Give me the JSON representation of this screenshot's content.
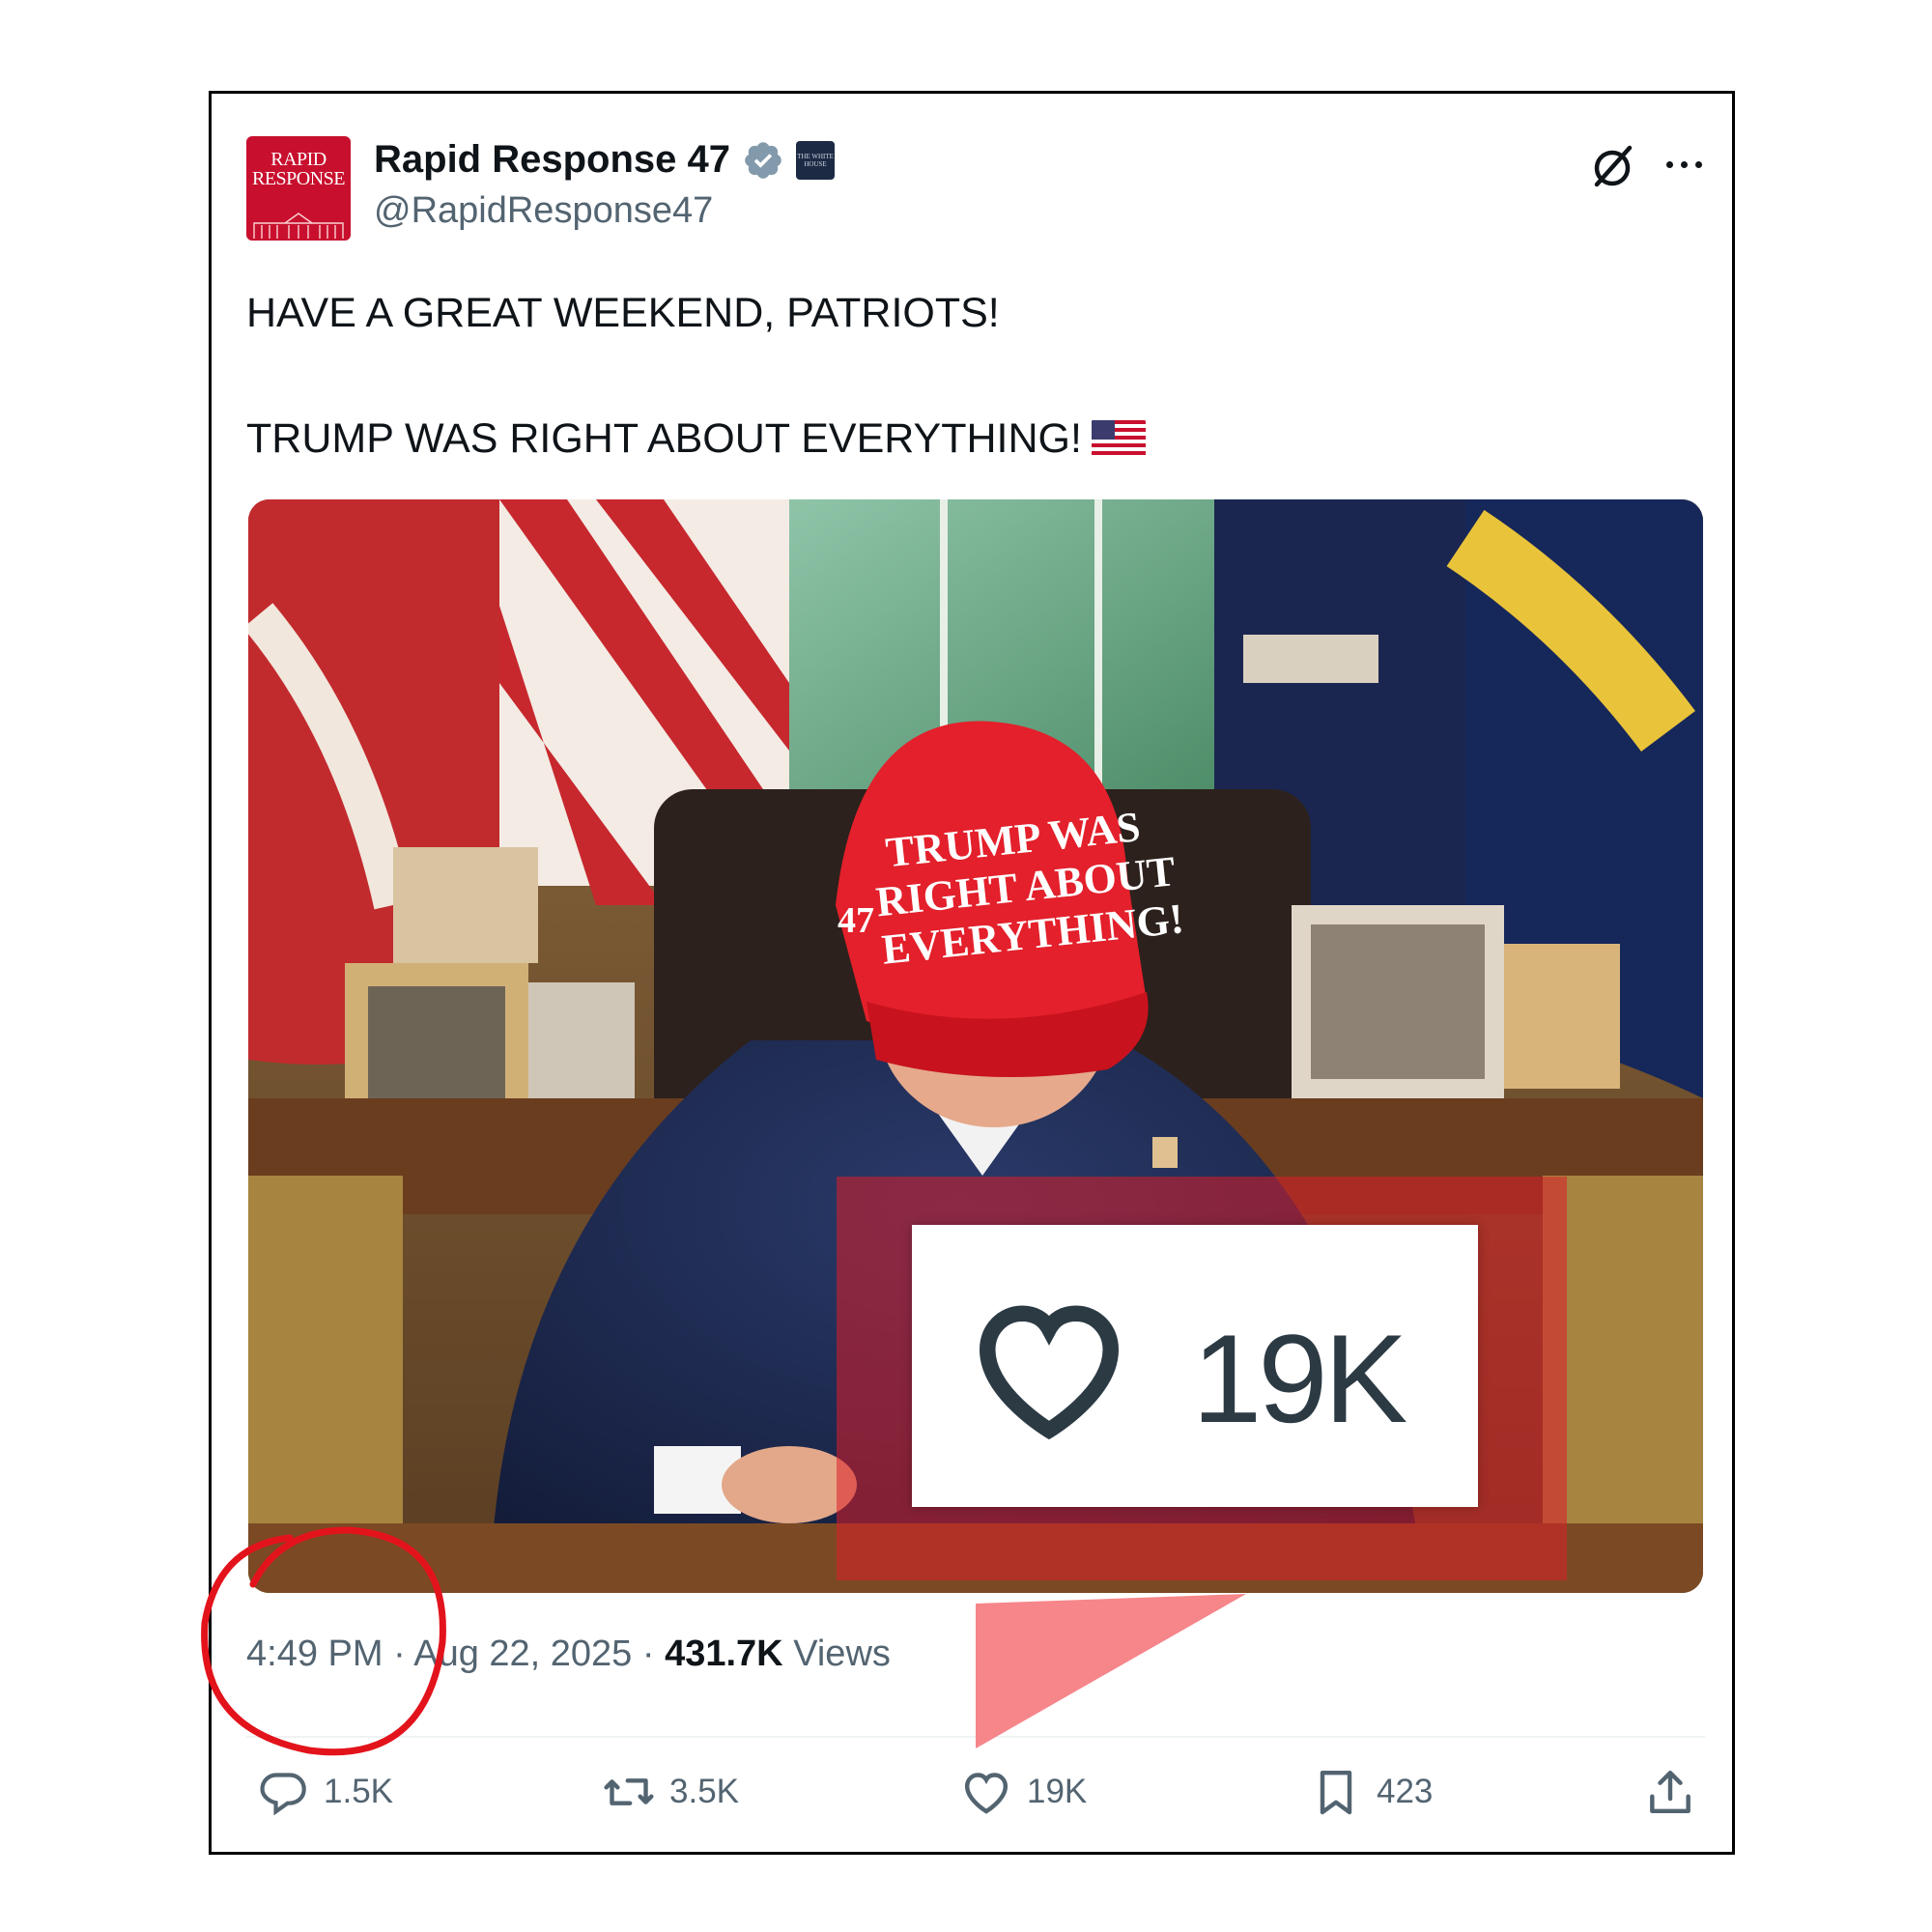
{
  "tweet": {
    "display_name": "Rapid Response 47",
    "handle": "@RapidResponse47",
    "avatar_text": [
      "RAPID",
      "RESPONSE"
    ],
    "affiliate_badge_text": "THE WHITE HOUSE",
    "text_line_1": "HAVE A GREAT WEEKEND, PATRIOTS!",
    "text_line_2": "TRUMP WAS RIGHT ABOUT EVERYTHING!",
    "flag_emoji": "us-flag-icon",
    "media": {
      "hat_text": [
        "TRUMP WAS",
        "RIGHT ABOUT",
        "EVERYTHING!"
      ],
      "hat_side_text": "47",
      "hat_color": "#e3202b"
    },
    "time": "4:49 PM",
    "separator": "·",
    "date": "Aug 22, 2025",
    "views_count": "431.7K",
    "views_label": "Views"
  },
  "actions": {
    "replies": "1.5K",
    "reposts": "3.5K",
    "likes": "19K",
    "bookmarks": "423"
  },
  "zoom": {
    "likes": "19K"
  },
  "colors": {
    "verified": "#829aab",
    "secondary_text": "#536471",
    "annotation_red": "#e3131c",
    "overlay_red": "rgba(220,30,40,0.55)",
    "pointer_pink": "#f6868a"
  }
}
